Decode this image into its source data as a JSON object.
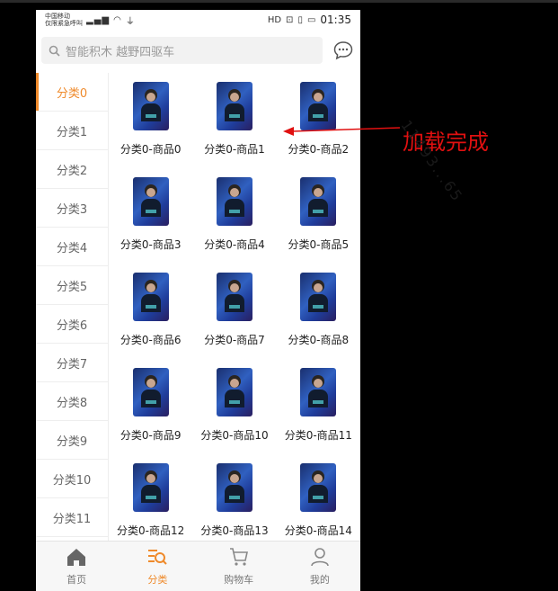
{
  "status_bar": {
    "carrier_line1": "中国移动",
    "carrier_line2": "仅限紧急呼叫",
    "signal": "⁴⁶ıll",
    "time": "01:35"
  },
  "search": {
    "placeholder": "智能积木 越野四驱车"
  },
  "categories": [
    "分类0",
    "分类1",
    "分类2",
    "分类3",
    "分类4",
    "分类5",
    "分类6",
    "分类7",
    "分类8",
    "分类9",
    "分类10",
    "分类11"
  ],
  "active_category": "分类0",
  "products": [
    "分类0-商品0",
    "分类0-商品1",
    "分类0-商品2",
    "分类0-商品3",
    "分类0-商品4",
    "分类0-商品5",
    "分类0-商品6",
    "分类0-商品7",
    "分类0-商品8",
    "分类0-商品9",
    "分类0-商品10",
    "分类0-商品11",
    "分类0-商品12",
    "分类0-商品13",
    "分类0-商品14"
  ],
  "tabs": [
    {
      "label": "首页",
      "icon": "home-icon"
    },
    {
      "label": "分类",
      "icon": "category-search-icon"
    },
    {
      "label": "购物车",
      "icon": "cart-icon"
    },
    {
      "label": "我的",
      "icon": "profile-icon"
    }
  ],
  "active_tab": "分类",
  "annotation": {
    "text": "加载完成",
    "watermark": "11493...65"
  },
  "colors": {
    "accent": "#ef8a2b",
    "annotation": "#e01010",
    "background": "#000000"
  }
}
